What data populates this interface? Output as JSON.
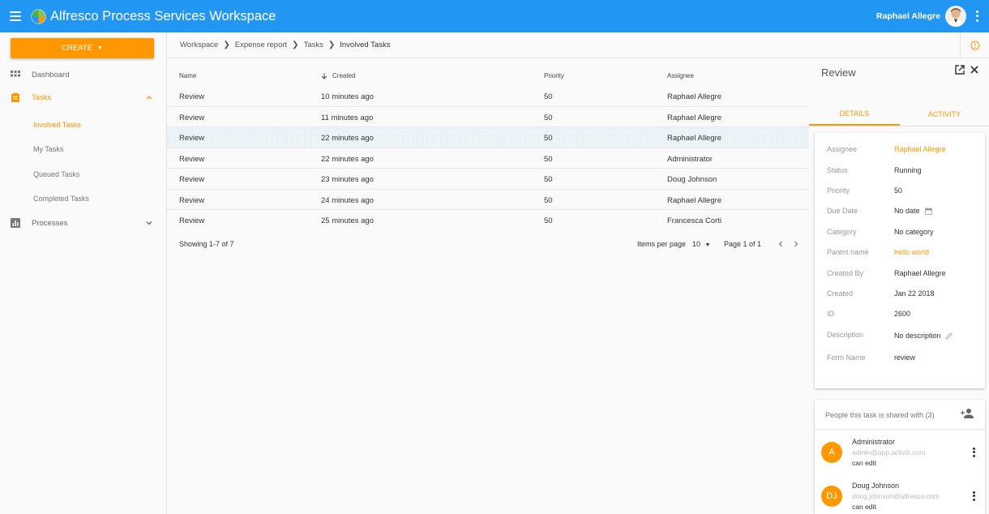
{
  "header": {
    "title": "Alfresco Process Services Workspace",
    "user_name": "Raphael Allegre",
    "brand_color": "#2196f3"
  },
  "sidebar": {
    "create_label": "CREATE",
    "accent_color": "#ff9800",
    "items": [
      {
        "label": "Dashboard",
        "icon": "grid-icon"
      },
      {
        "label": "Tasks",
        "icon": "clipboard-icon"
      },
      {
        "label": "Processes",
        "icon": "bar-chart-icon"
      }
    ],
    "task_filters": [
      "Involved Tasks",
      "My Tasks",
      "Queued Tasks",
      "Completed Tasks"
    ]
  },
  "breadcrumb": [
    "Workspace",
    "Expense report",
    "Tasks",
    "Involved Tasks"
  ],
  "table": {
    "columns": [
      "Name",
      "Created",
      "Priority",
      "Assignee"
    ],
    "rows": [
      {
        "name": "Review",
        "created": "10 minutes ago",
        "priority": "50",
        "assignee": "Raphael Allegre"
      },
      {
        "name": "Review",
        "created": "11 minutes ago",
        "priority": "50",
        "assignee": "Raphael Allegre"
      },
      {
        "name": "Review",
        "created": "22 minutes ago",
        "priority": "50",
        "assignee": "Raphael Allegre"
      },
      {
        "name": "Review",
        "created": "22 minutes ago",
        "priority": "50",
        "assignee": "Administrator"
      },
      {
        "name": "Review",
        "created": "23 minutes ago",
        "priority": "50",
        "assignee": "Doug Johnson"
      },
      {
        "name": "Review",
        "created": "24 minutes ago",
        "priority": "50",
        "assignee": "Raphael Allegre"
      },
      {
        "name": "Review",
        "created": "25 minutes ago",
        "priority": "50",
        "assignee": "Francesca Corti"
      }
    ]
  },
  "pagination": {
    "showing": "Showing 1-7 of 7",
    "items_per_page_label": "Items per page",
    "items_per_page": "10",
    "page_label": "Page 1 of 1"
  },
  "details": {
    "title": "Review",
    "tabs": [
      "DETAILS",
      "ACTIVITY"
    ],
    "properties": [
      {
        "label": "Assignee",
        "value": "Raphael Allegre"
      },
      {
        "label": "Status",
        "value": "Running"
      },
      {
        "label": "Priority",
        "value": "50"
      },
      {
        "label": "Due Date",
        "value": "No date"
      },
      {
        "label": "Category",
        "value": "No category"
      },
      {
        "label": "Parent name",
        "value": "hello world"
      },
      {
        "label": "Created By",
        "value": "Raphael Allegre"
      },
      {
        "label": "Created",
        "value": "Jan 22 2018"
      },
      {
        "label": "ID",
        "value": "2600"
      },
      {
        "label": "Description",
        "value": "No description"
      },
      {
        "label": "Form Name",
        "value": "review"
      }
    ]
  },
  "people": {
    "header": "People this task is shared with (3)",
    "list": [
      {
        "initials": "A",
        "name": "Administrator",
        "email": "admin@app.activiti.com",
        "permission": "can edit"
      },
      {
        "initials": "DJ",
        "name": "Doug Johnson",
        "email": "doug.johnson@alfresco.com",
        "permission": "can edit"
      }
    ]
  }
}
